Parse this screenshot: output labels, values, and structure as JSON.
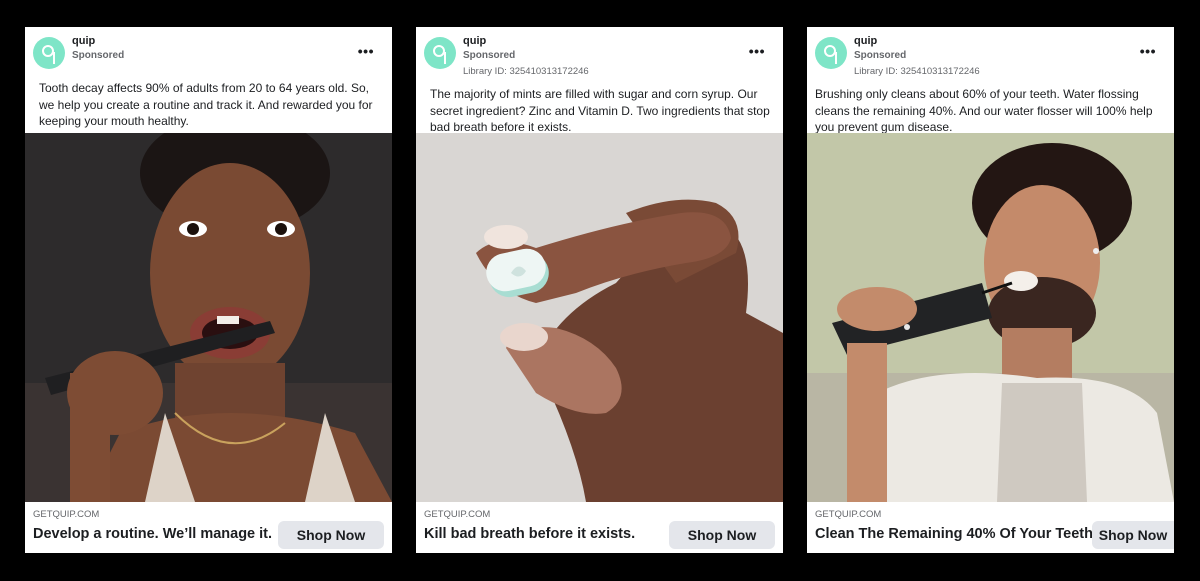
{
  "brand_color": "#7ee5c7",
  "ads": [
    {
      "brand": "quip",
      "sponsored": "Sponsored",
      "library_id": "",
      "caption": "Tooth decay affects 90% of adults from 20 to 64 years old. So, we help you create a routine and track it. And rewarded you for keeping your mouth healthy.",
      "domain": "GETQUIP.COM",
      "headline": "Develop a routine. We’ll manage it.",
      "cta": "Shop Now"
    },
    {
      "brand": "quip",
      "sponsored": "Sponsored",
      "library_id": "Library ID: 325410313172246",
      "caption": "The majority of mints are filled with sugar and corn syrup. Our secret ingredient? Zinc and Vitamin D. Two ingredients that stop bad breath before it exists.",
      "domain": "GETQUIP.COM",
      "headline": "Kill bad breath before it exists.",
      "cta": "Shop Now"
    },
    {
      "brand": "quip",
      "sponsored": "Sponsored",
      "library_id": "Library ID: 325410313172246",
      "caption": "Brushing only cleans about 60% of your teeth. Water flossing cleans the remaining 40%. And our water flosser will 100% help you prevent gum disease.",
      "domain": "GETQUIP.COM",
      "headline": "Clean The Remaining 40% Of Your Teeth",
      "cta": "Shop Now"
    }
  ]
}
